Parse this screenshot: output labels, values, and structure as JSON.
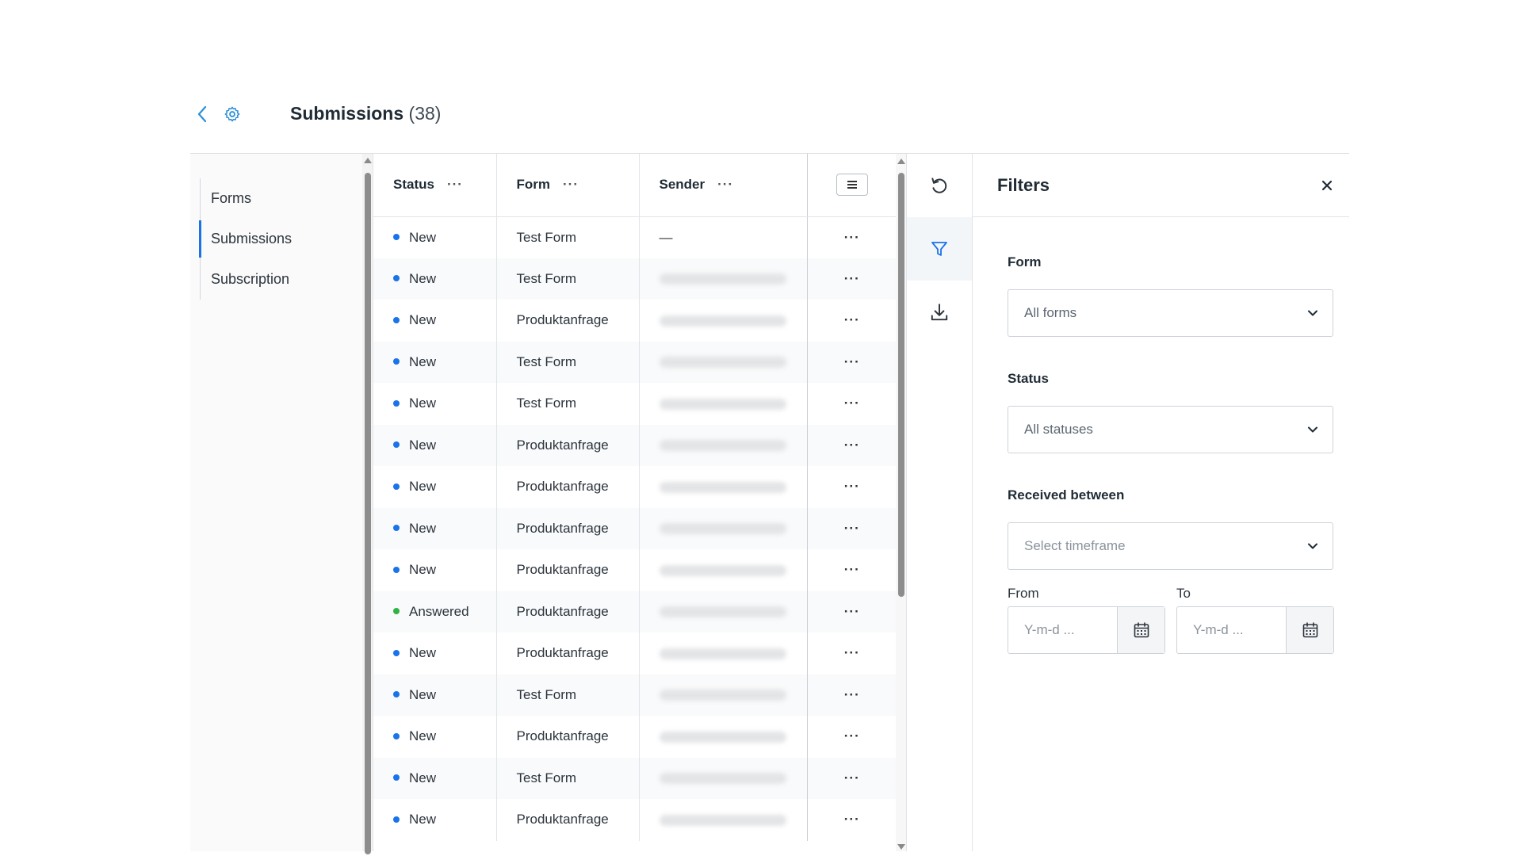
{
  "header": {
    "title": "Submissions",
    "count": "(38)",
    "back_icon": "chevron-left-icon",
    "settings_icon": "gear-icon"
  },
  "sidebar": {
    "items": [
      {
        "label": "Forms",
        "active": false
      },
      {
        "label": "Submissions",
        "active": true
      },
      {
        "label": "Subscription",
        "active": false
      }
    ]
  },
  "table": {
    "columns": [
      {
        "label": "Status",
        "menu": "···"
      },
      {
        "label": "Form",
        "menu": "···"
      },
      {
        "label": "Sender",
        "menu": "···"
      }
    ],
    "row_menu": "···",
    "rows": [
      {
        "status": "New",
        "status_color": "#1a73e8",
        "form": "Test Form",
        "sender": "—"
      },
      {
        "status": "New",
        "status_color": "#1a73e8",
        "form": "Test Form",
        "sender": ""
      },
      {
        "status": "New",
        "status_color": "#1a73e8",
        "form": "Produktanfrage",
        "sender": ""
      },
      {
        "status": "New",
        "status_color": "#1a73e8",
        "form": "Test Form",
        "sender": ""
      },
      {
        "status": "New",
        "status_color": "#1a73e8",
        "form": "Test Form",
        "sender": ""
      },
      {
        "status": "New",
        "status_color": "#1a73e8",
        "form": "Produktanfrage",
        "sender": ""
      },
      {
        "status": "New",
        "status_color": "#1a73e8",
        "form": "Produktanfrage",
        "sender": ""
      },
      {
        "status": "New",
        "status_color": "#1a73e8",
        "form": "Produktanfrage",
        "sender": ""
      },
      {
        "status": "New",
        "status_color": "#1a73e8",
        "form": "Produktanfrage",
        "sender": ""
      },
      {
        "status": "Answered",
        "status_color": "#2fb344",
        "form": "Produktanfrage",
        "sender": ""
      },
      {
        "status": "New",
        "status_color": "#1a73e8",
        "form": "Produktanfrage",
        "sender": ""
      },
      {
        "status": "New",
        "status_color": "#1a73e8",
        "form": "Test Form",
        "sender": ""
      },
      {
        "status": "New",
        "status_color": "#1a73e8",
        "form": "Produktanfrage",
        "sender": ""
      },
      {
        "status": "New",
        "status_color": "#1a73e8",
        "form": "Test Form",
        "sender": ""
      },
      {
        "status": "New",
        "status_color": "#1a73e8",
        "form": "Produktanfrage",
        "sender": ""
      }
    ]
  },
  "tools": {
    "icons": [
      "refresh-icon",
      "filter-icon",
      "download-icon"
    ],
    "accent": "#1a73e8"
  },
  "filters": {
    "title": "Filters",
    "form_label": "Form",
    "form_value": "All forms",
    "status_label": "Status",
    "status_value": "All statuses",
    "received_label": "Received between",
    "received_placeholder": "Select timeframe",
    "from_label": "From",
    "from_placeholder": "Y-m-d ...",
    "to_label": "To",
    "to_placeholder": "Y-m-d ..."
  }
}
